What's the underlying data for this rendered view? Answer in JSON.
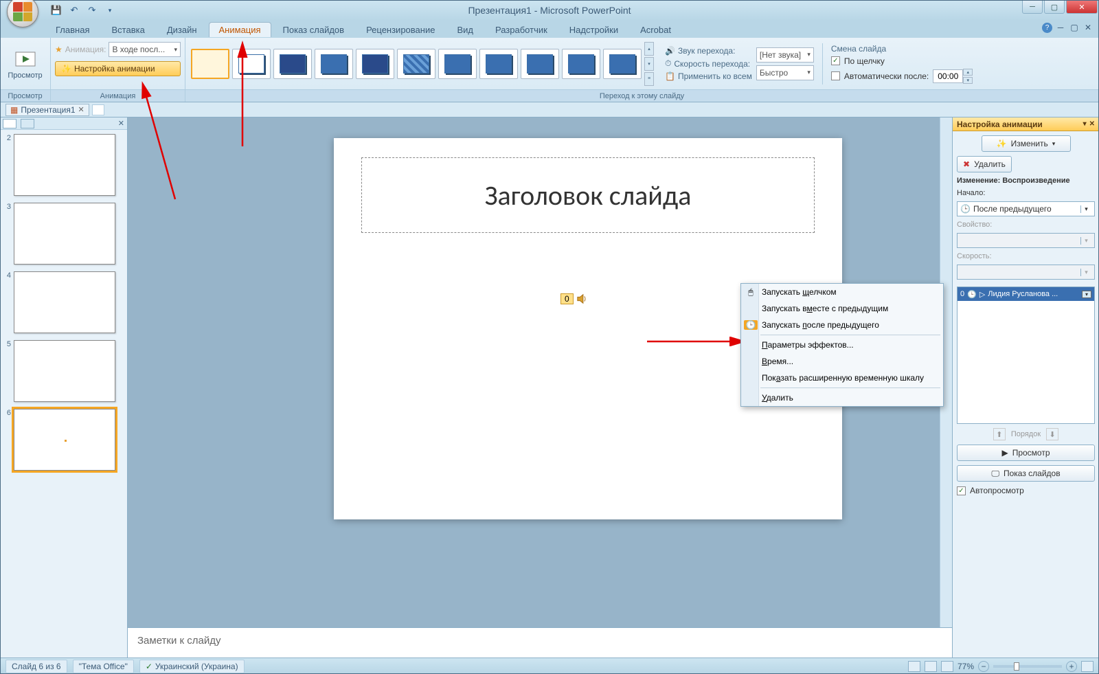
{
  "title": "Презентация1 - Microsoft PowerPoint",
  "tabs": [
    "Главная",
    "Вставка",
    "Дизайн",
    "Анимация",
    "Показ слайдов",
    "Рецензирование",
    "Вид",
    "Разработчик",
    "Надстройки",
    "Acrobat"
  ],
  "active_tab_index": 3,
  "ribbon": {
    "preview_group": {
      "btn": "Просмотр",
      "label": "Просмотр"
    },
    "anim_group": {
      "combo_label": "Анимация:",
      "combo_value": "В ходе посл...",
      "settings_btn": "Настройка анимации",
      "label": "Анимация"
    },
    "transition_group": {
      "sound_label": "Звук перехода:",
      "sound_value": "[Нет звука]",
      "speed_label": "Скорость перехода:",
      "speed_value": "Быстро",
      "apply_all": "Применить ко всем",
      "group_label": "Переход к этому слайду"
    },
    "advance_group": {
      "title": "Смена слайда",
      "on_click": "По щелчку",
      "auto_after": "Автоматически после:",
      "time": "00:00"
    }
  },
  "doc_tab": "Презентация1",
  "thumbs": [
    2,
    3,
    4,
    5,
    6
  ],
  "selected_thumb": 6,
  "slide": {
    "title_placeholder": "Заголовок слайда",
    "sound_badge": "0"
  },
  "notes_placeholder": "Заметки к слайду",
  "taskpane": {
    "title": "Настройка анимации",
    "change_btn": "Изменить",
    "delete_btn": "Удалить",
    "section": "Изменение: Воспроизведение",
    "start_label": "Начало:",
    "start_value": "После предыдущего",
    "property_label": "Свойство:",
    "speed_label": "Скорость:",
    "anim_entry_num": "0",
    "anim_entry": "Лидия Русланова ...",
    "order_label": "Порядок",
    "preview_btn": "Просмотр",
    "slideshow_btn": "Показ слайдов",
    "autopreview": "Автопросмотр"
  },
  "context_menu": [
    {
      "icon": "mouse",
      "label_pre": "Запускать ",
      "u": "щ",
      "label_post": "елчком"
    },
    {
      "icon": "",
      "label_pre": "Запускать в",
      "u": "м",
      "label_post": "есте с предыдущим"
    },
    {
      "icon": "clock",
      "label_pre": "Запускать ",
      "u": "п",
      "label_post": "осле предыдущего",
      "sep_after": true
    },
    {
      "icon": "",
      "label_pre": "",
      "u": "П",
      "label_post": "араметры эффектов..."
    },
    {
      "icon": "",
      "label_pre": "",
      "u": "В",
      "label_post": "ремя..."
    },
    {
      "icon": "",
      "label_pre": "Пок",
      "u": "а",
      "label_post": "зать расширенную временную шкалу",
      "sep_after": true
    },
    {
      "icon": "",
      "label_pre": "",
      "u": "У",
      "label_post": "далить"
    }
  ],
  "status": {
    "slide_info": "Слайд 6 из 6",
    "theme": "\"Тема Office\"",
    "lang": "Украинский (Украина)",
    "zoom": "77%"
  }
}
